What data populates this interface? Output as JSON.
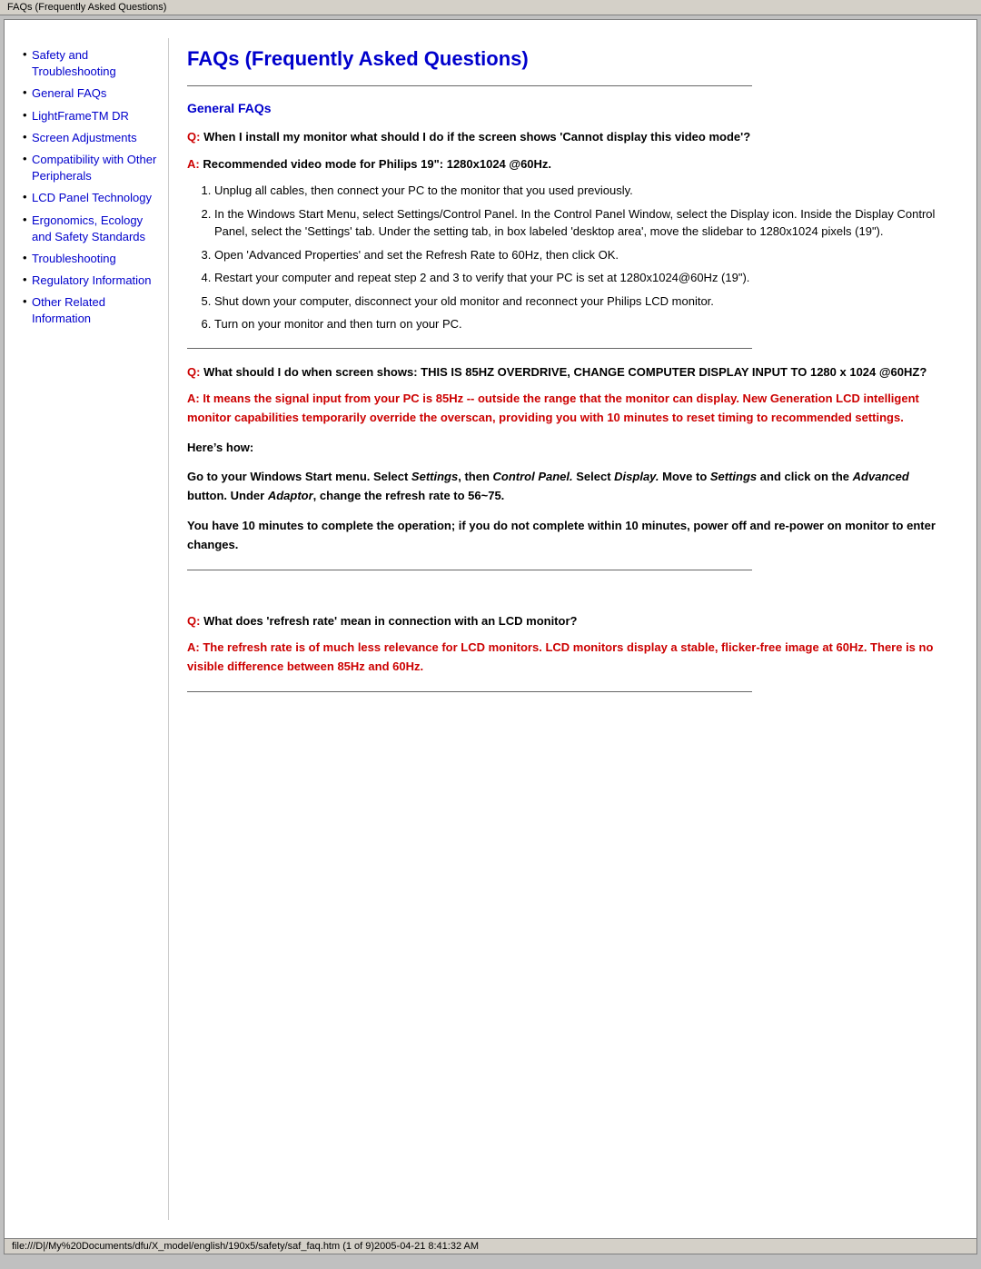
{
  "titleBar": {
    "text": "FAQs (Frequently Asked Questions)"
  },
  "sidebar": {
    "items": [
      {
        "id": "safety",
        "label": "Safety and Troubleshooting",
        "href": "#"
      },
      {
        "id": "general-faqs",
        "label": "General FAQs",
        "href": "#"
      },
      {
        "id": "lightframe",
        "label": "LightFrameTM DR",
        "href": "#"
      },
      {
        "id": "screen",
        "label": "Screen Adjustments",
        "href": "#"
      },
      {
        "id": "compatibility",
        "label": "Compatibility with Other Peripherals",
        "href": "#"
      },
      {
        "id": "lcd",
        "label": "LCD Panel Technology",
        "href": "#"
      },
      {
        "id": "ergonomics",
        "label": "Ergonomics, Ecology and Safety Standards",
        "href": "#"
      },
      {
        "id": "troubleshooting",
        "label": "Troubleshooting",
        "href": "#"
      },
      {
        "id": "regulatory",
        "label": "Regulatory Information",
        "href": "#"
      },
      {
        "id": "other",
        "label": "Other Related Information",
        "href": "#"
      }
    ]
  },
  "main": {
    "pageTitle": "FAQs (Frequently Asked Questions)",
    "sectionHeading": "General FAQs",
    "questions": [
      {
        "id": "q1",
        "qLabel": "Q:",
        "questionText": " When I install my monitor what should I do if the screen shows 'Cannot display this video mode'?",
        "aLabel": "A:",
        "answerBold": " Recommended video mode for Philips 19\": 1280x1024 @60Hz.",
        "listItems": [
          "Unplug all cables, then connect your PC to the monitor that you used previously.",
          "In the Windows Start Menu, select Settings/Control Panel. In the Control Panel Window, select the Display icon. Inside the Display Control Panel, select the 'Settings' tab. Under the setting tab, in box labeled 'desktop area', move the slidebar to 1280x1024 pixels (19\").",
          "Open 'Advanced Properties' and set the Refresh Rate to 60Hz, then click OK.",
          "Restart your computer and repeat step 2 and 3 to verify that your PC is set at 1280x1024@60Hz (19\").",
          "Shut down your computer, disconnect your old monitor and reconnect your Philips LCD monitor.",
          "Turn on your monitor and then turn on your PC."
        ]
      },
      {
        "id": "q2",
        "qLabel": "Q:",
        "questionText": " What should I do when screen shows: THIS IS 85HZ OVERDRIVE, CHANGE COMPUTER DISPLAY INPUT TO 1280 x 1024 @60HZ?",
        "aLabel": "A:",
        "answerColorText": " It means the signal input from your PC is 85Hz -- outside the range that the monitor can display. New Generation LCD intelligent monitor capabilities temporarily override the overscan, providing you with 10 minutes to reset timing to recommended settings.",
        "herePara": "Here’s how:",
        "goPara": "Go to your Windows Start menu. Select Settings, then Control Panel. Select Display. Move to Settings and click on the Advanced button. Under Adaptor, change the refresh rate to 56~75.",
        "minutesPara": "You have 10 minutes to complete the operation; if you do not complete within 10 minutes, power off and re-power on monitor to enter changes."
      },
      {
        "id": "q3",
        "qLabel": "Q:",
        "questionText": " What does 'refresh rate' mean in connection with an LCD monitor?",
        "aLabel": "A:",
        "answerColorText": " The refresh rate is of much less relevance for LCD monitors. LCD monitors display a stable, flicker-free image at 60Hz. There is no visible difference between 85Hz and 60Hz."
      }
    ]
  },
  "statusBar": {
    "text": "file:///D|/My%20Documents/dfu/X_model/english/190x5/safety/saf_faq.htm (1 of 9)2005-04-21 8:41:32 AM"
  }
}
